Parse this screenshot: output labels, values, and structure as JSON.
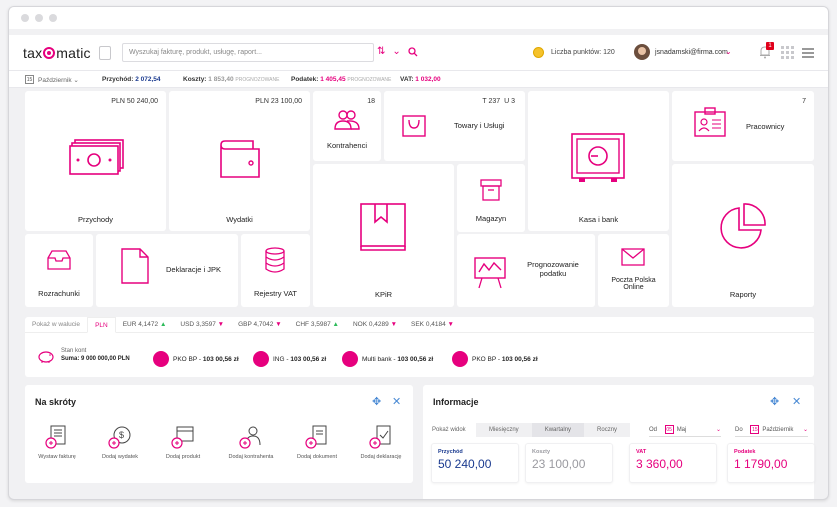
{
  "header": {
    "logo_text_a": "tax",
    "logo_text_b": "matic",
    "search_placeholder": "Wyszukaj fakturę, produkt, usługę, raport...",
    "points_label": "Liczba punktów: 120",
    "user_email": "jsnadamski@firma.com",
    "notifications_count": "1"
  },
  "statbar": {
    "calendar_num": "15",
    "month": "Październik",
    "przychod_label": "Przychód:",
    "przychod_value": "2 072,54",
    "koszty_label": "Koszty:",
    "koszty_value": "1 853,40",
    "koszty_sub": "PROGNOZOWANE",
    "podatek_label": "Podatek:",
    "podatek_value": "1 405,45",
    "podatek_sub": "PROGNOZOWANE",
    "vat_label": "VAT:",
    "vat_value": "1 032,00"
  },
  "tiles": {
    "przychody": {
      "label": "Przychody",
      "amount": "PLN 50 240,00"
    },
    "wydatki": {
      "label": "Wydatki",
      "amount": "PLN 23 100,00"
    },
    "kontrahenci": {
      "label": "Kontrahenci",
      "count": "18"
    },
    "towary": {
      "label": "Towary i Usługi",
      "count_t": "T 237",
      "count_u": "U 3"
    },
    "kasa": {
      "label": "Kasa i bank"
    },
    "pracownicy": {
      "label": "Pracownicy",
      "count": "7"
    },
    "magazyn": {
      "label": "Magazyn"
    },
    "kpir": {
      "label": "KPiR"
    },
    "raporty": {
      "label": "Raporty"
    },
    "rozrachunki": {
      "label": "Rozrachunki"
    },
    "deklaracje": {
      "label": "Deklaracje i JPK"
    },
    "rejestry": {
      "label": "Rejestry VAT"
    },
    "prognozowanie": {
      "label_1": "Prognozowanie",
      "label_2": "podatku"
    },
    "poczta": {
      "label_1": "Poczta Polska",
      "label_2": "Online"
    }
  },
  "currency": {
    "show_label": "Pokaż w walucie",
    "tabs": [
      {
        "code": "PLN",
        "rate": "",
        "dir": ""
      },
      {
        "code": "EUR",
        "rate": "4,1472",
        "dir": "up"
      },
      {
        "code": "USD",
        "rate": "3,3597",
        "dir": "down"
      },
      {
        "code": "GBP",
        "rate": "4,7042",
        "dir": "down"
      },
      {
        "code": "CHF",
        "rate": "3,5987",
        "dir": "up"
      },
      {
        "code": "NOK",
        "rate": "0,4289",
        "dir": "down"
      },
      {
        "code": "SEK",
        "rate": "0,4184",
        "dir": "down"
      }
    ],
    "account_label": "Stan kont",
    "account_sum": "Suma: 9 000 000,00 PLN",
    "banks": [
      {
        "name": "PKO BP",
        "amount": "103 00,56 zł"
      },
      {
        "name": "ING",
        "amount": "103 00,56 zł"
      },
      {
        "name": "Multi bank",
        "amount": "103 00,56 zł"
      },
      {
        "name": "PKO BP",
        "amount": "103 00,56 zł"
      }
    ]
  },
  "shortcuts": {
    "title": "Na skróty",
    "items": [
      "Wystaw fakturę",
      "Dodaj wydatek",
      "Dodaj produkt",
      "Dodaj kontrahenta",
      "Dodaj dokument",
      "Dodaj deklarację"
    ]
  },
  "info": {
    "title": "Informacje",
    "view_label": "Pokaż widok",
    "periods": [
      "Miesięczny",
      "Kwartalny",
      "Roczny"
    ],
    "from_label": "Od",
    "from_cal": "05",
    "from_value": "Maj",
    "to_label": "Do",
    "to_cal": "15",
    "to_value": "Październik",
    "cards": [
      {
        "title": "Przychód",
        "value": "50 240,00",
        "color": "#1a3a8f"
      },
      {
        "title": "Koszty",
        "value": "23 100,00",
        "color": "#9a9aa0"
      },
      {
        "title": "VAT",
        "value": "3 360,00",
        "color": "#e6007e"
      },
      {
        "title": "Podatek",
        "value": "1 1790,00",
        "color": "#e6007e"
      }
    ]
  },
  "colors": {
    "accent": "#e6007e",
    "blue": "#4a8ad4",
    "navy": "#1a3a8f"
  }
}
